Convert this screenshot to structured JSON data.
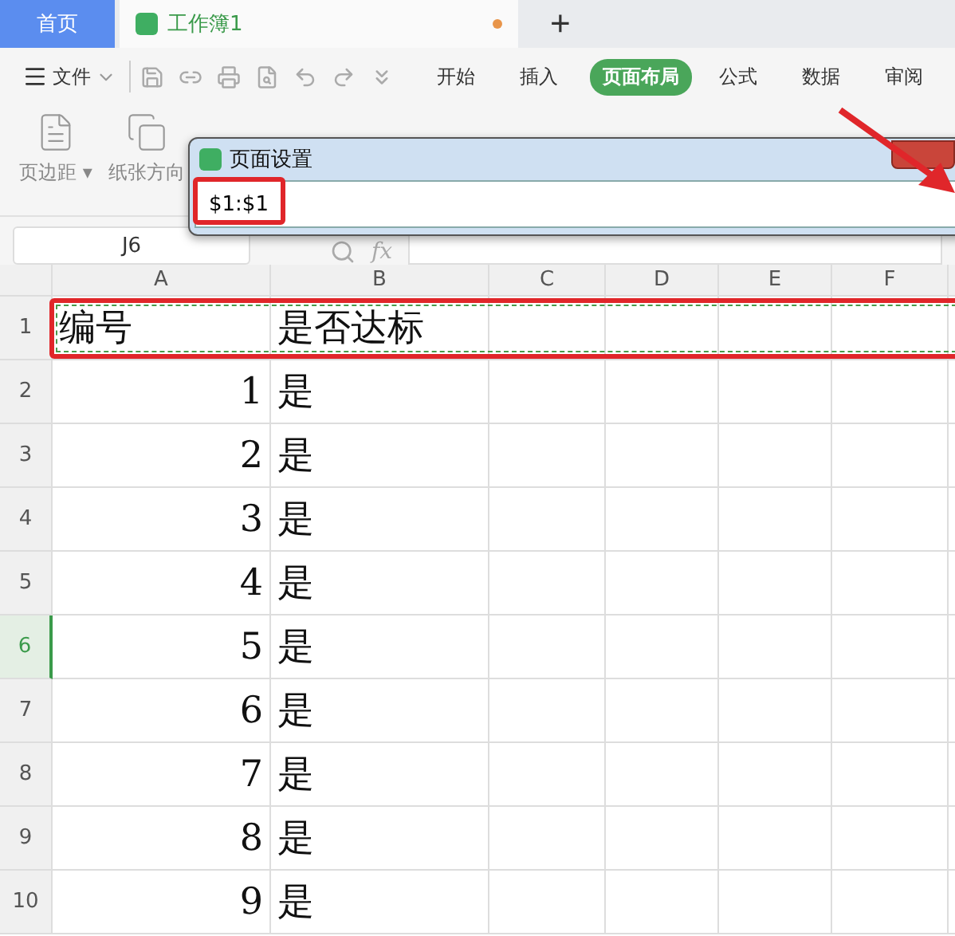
{
  "tabs": [
    {
      "label": "首页",
      "kind": "home",
      "selected": false,
      "modified": false
    },
    {
      "label": "工作簿1",
      "kind": "doc",
      "selected": true,
      "modified": true
    }
  ],
  "new_tab": "+",
  "menu": {
    "file": "文件",
    "tabs": [
      {
        "label": "开始",
        "selected": false
      },
      {
        "label": "插入",
        "selected": false
      },
      {
        "label": "页面布局",
        "selected": true
      },
      {
        "label": "公式",
        "selected": false
      },
      {
        "label": "数据",
        "selected": false
      },
      {
        "label": "审阅",
        "selected": false
      }
    ]
  },
  "ribbon": [
    {
      "label": "页边距",
      "caret": "▾"
    },
    {
      "label": "纸张方向"
    }
  ],
  "formula_bar": {
    "cell": "J6",
    "fx": "fx"
  },
  "columns": [
    "A",
    "B",
    "C",
    "D",
    "E",
    "F"
  ],
  "rows": [
    {
      "number": "1",
      "selected": false,
      "annotated": true,
      "cells": [
        {
          "text": "编号",
          "kind": "text"
        },
        {
          "text": "是否达标",
          "kind": "text"
        }
      ]
    },
    {
      "number": "2",
      "selected": false,
      "annotated": false,
      "cells": [
        {
          "text": "1",
          "kind": "number"
        },
        {
          "text": "是",
          "kind": "text"
        }
      ]
    },
    {
      "number": "3",
      "selected": false,
      "annotated": false,
      "cells": [
        {
          "text": "2",
          "kind": "number"
        },
        {
          "text": "是",
          "kind": "text"
        }
      ]
    },
    {
      "number": "4",
      "selected": false,
      "annotated": false,
      "cells": [
        {
          "text": "3",
          "kind": "number"
        },
        {
          "text": "是",
          "kind": "text"
        }
      ]
    },
    {
      "number": "5",
      "selected": false,
      "annotated": false,
      "cells": [
        {
          "text": "4",
          "kind": "number"
        },
        {
          "text": "是",
          "kind": "text"
        }
      ]
    },
    {
      "number": "6",
      "selected": true,
      "annotated": false,
      "cells": [
        {
          "text": "5",
          "kind": "number"
        },
        {
          "text": "是",
          "kind": "text"
        }
      ]
    },
    {
      "number": "7",
      "selected": false,
      "annotated": false,
      "cells": [
        {
          "text": "6",
          "kind": "number"
        },
        {
          "text": "是",
          "kind": "text"
        }
      ]
    },
    {
      "number": "8",
      "selected": false,
      "annotated": false,
      "cells": [
        {
          "text": "7",
          "kind": "number"
        },
        {
          "text": "是",
          "kind": "text"
        }
      ]
    },
    {
      "number": "9",
      "selected": false,
      "annotated": false,
      "cells": [
        {
          "text": "8",
          "kind": "number"
        },
        {
          "text": "是",
          "kind": "text"
        }
      ]
    },
    {
      "number": "10",
      "selected": false,
      "annotated": false,
      "cells": [
        {
          "text": "9",
          "kind": "number"
        },
        {
          "text": "是",
          "kind": "text"
        }
      ]
    }
  ],
  "dialog": {
    "title": "页面设置",
    "value": "$1:$1",
    "annotated": true
  }
}
